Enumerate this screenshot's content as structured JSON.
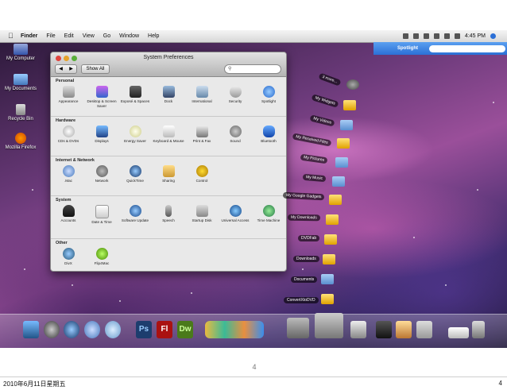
{
  "menubar": {
    "app": "Finder",
    "items": [
      "File",
      "Edit",
      "View",
      "Go",
      "Window",
      "Help"
    ],
    "clock": "4:45 PM"
  },
  "spotlight": {
    "label": "Spotlight"
  },
  "desktop_icons": [
    {
      "label": "My Computer"
    },
    {
      "label": "My Documents"
    },
    {
      "label": "Recycle Bin"
    },
    {
      "label": "Mozilla Firefox"
    }
  ],
  "window": {
    "title": "System Preferences",
    "show_all": "Show All",
    "sections": [
      {
        "heading": "Personal",
        "panes": [
          "Appearance",
          "Desktop & Screen Saver",
          "Exposé & Spaces",
          "Dock",
          "International",
          "Security",
          "Spotlight"
        ]
      },
      {
        "heading": "Hardware",
        "panes": [
          "CDs & DVDs",
          "Displays",
          "Energy Saver",
          "Keyboard & Mouse",
          "Print & Fax",
          "Sound",
          "Bluetooth"
        ]
      },
      {
        "heading": "Internet & Network",
        "panes": [
          ".Mac",
          "Network",
          "QuickTime",
          "Sharing",
          "Control"
        ]
      },
      {
        "heading": "System",
        "panes": [
          "Accounts",
          "Date & Time",
          "Software Update",
          "Speech",
          "Startup Disk",
          "Universal Access",
          "Time Machine"
        ]
      },
      {
        "heading": "Other",
        "panes": [
          "DivX",
          "Flip4Mac"
        ]
      }
    ]
  },
  "stack": {
    "items": [
      "3 more...",
      "My Widgets",
      "My Videos",
      "My Received Files",
      "My Pictures",
      "My Music",
      "My Google Gadgets",
      "My Downloads",
      "DVDFab",
      "Downloads",
      "Documents",
      "ConvertXtoDVD"
    ]
  },
  "dock_text": {
    "ps": "Ps",
    "fl": "Fl",
    "dw": "Dw"
  },
  "footer": {
    "page_number": "4",
    "date": "2010年6月11日星期五",
    "slide_number": "4"
  }
}
